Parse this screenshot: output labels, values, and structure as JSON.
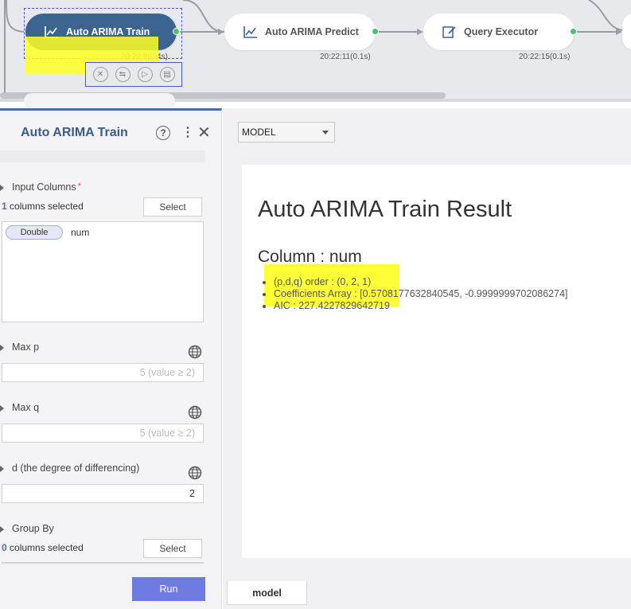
{
  "workflow": {
    "nodes": [
      {
        "label": "Auto ARIMA Train",
        "time": "20:22:8(0.4s)",
        "state": "selected",
        "icon": "line-chart-icon"
      },
      {
        "label": "Auto ARIMA Predict",
        "time": "20:22:11(0.1s)",
        "state": "done",
        "icon": "line-chart-icon"
      },
      {
        "label": "Query Executor",
        "time": "20:22:15(0.1s)",
        "state": "done",
        "icon": "edit-icon"
      }
    ],
    "toolbar_icons": [
      "cancel-icon",
      "link-icon",
      "play-icon",
      "clipboard-icon"
    ]
  },
  "panel": {
    "title": "Auto ARIMA Train",
    "input_columns": {
      "label": "Input Columns",
      "required_mark": "*",
      "count": "1",
      "count_suffix": "columns selected",
      "select_label": "Select",
      "items": [
        {
          "type": "Double",
          "name": "num"
        }
      ]
    },
    "max_p": {
      "label": "Max p",
      "placeholder": "5 (value ≥ 2)"
    },
    "max_q": {
      "label": "Max q",
      "placeholder": "5 (value ≥ 2)"
    },
    "d": {
      "label": "d (the degree of differencing)",
      "value": "2"
    },
    "group_by": {
      "label": "Group By",
      "count": "0",
      "count_suffix": "columns selected",
      "select_label": "Select"
    },
    "run_label": "Run"
  },
  "result": {
    "dropdown_value": "MODEL",
    "title": "Auto ARIMA Train Result",
    "column_heading": "Column : num",
    "metrics": [
      "(p,d,q) order : (0, 2, 1)",
      "Coefficients Array : [0.5708177632840545, -0.9999999702086274]",
      "AIC : 227.4227829642719"
    ],
    "tab_label": "model"
  },
  "colors": {
    "accent_node": "#3d6390",
    "run_button": "#6f7be0",
    "port_green": "#4cbf73",
    "highlight": "#ffff22"
  }
}
